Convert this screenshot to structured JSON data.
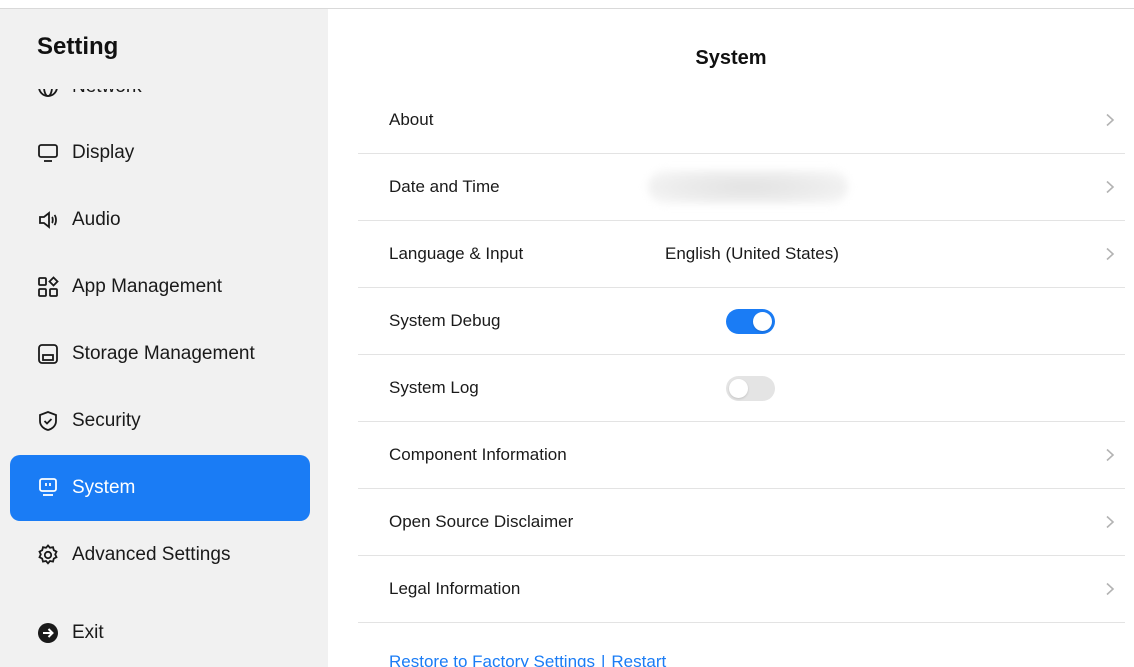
{
  "sidebar": {
    "title": "Setting",
    "items": [
      {
        "label": "Network",
        "icon": "globe-icon"
      },
      {
        "label": "Display",
        "icon": "monitor-icon"
      },
      {
        "label": "Audio",
        "icon": "speaker-icon"
      },
      {
        "label": "App Management",
        "icon": "apps-icon"
      },
      {
        "label": "Storage Management",
        "icon": "storage-icon"
      },
      {
        "label": "Security",
        "icon": "shield-check-icon"
      },
      {
        "label": "System",
        "icon": "system-icon",
        "active": true
      },
      {
        "label": "Advanced Settings",
        "icon": "gear-icon"
      },
      {
        "label": "Exit",
        "icon": "exit-arrow-icon"
      }
    ]
  },
  "main": {
    "title": "System",
    "rows": [
      {
        "label": "About",
        "value": "",
        "control": "chevron"
      },
      {
        "label": "Date and Time",
        "value": "",
        "control": "chevron"
      },
      {
        "label": "Language & Input",
        "value": "English (United States)",
        "control": "chevron"
      },
      {
        "label": "System Debug",
        "control": "toggle",
        "checked": true
      },
      {
        "label": "System Log",
        "control": "toggle",
        "checked": false
      },
      {
        "label": "Component Information",
        "control": "chevron"
      },
      {
        "label": "Open Source Disclaimer",
        "control": "chevron"
      },
      {
        "label": "Legal Information",
        "control": "chevron"
      }
    ],
    "footer": {
      "restore_label": "Restore to Factory Settings",
      "separator": "|",
      "restart_label": "Restart"
    }
  },
  "colors": {
    "accent": "#1a7cf5",
    "sidebar_bg": "#f1f1f1",
    "toggle_off": "#e4e4e4"
  }
}
